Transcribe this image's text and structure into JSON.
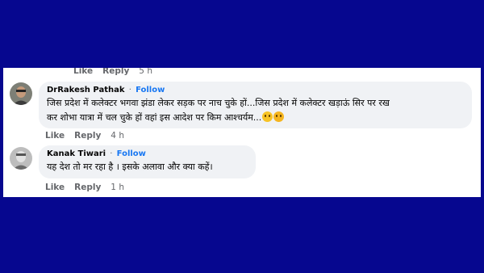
{
  "top_actions": {
    "like": "Like",
    "reply": "Reply",
    "time": "5 h"
  },
  "comments": [
    {
      "author": "DrRakesh Pathak",
      "separator": "·",
      "follow": "Follow",
      "line1": "जिस प्रदेश में कलेक्टर भगवा झंडा लेकर सड़क पर नाच चुके हों...जिस प्रदेश में कलेक्टर खड़ाऊं सिर पर रख",
      "line2": "कर शोभा यात्रा में चल चुके हों वहां इस आदेश पर किम आश्चर्यम...",
      "emojis": [
        "thinking-face-emoji",
        "flushed-face-emoji"
      ],
      "like": "Like",
      "reply": "Reply",
      "time": "4 h"
    },
    {
      "author": "Kanak Tiwari",
      "separator": "·",
      "follow": "Follow",
      "line1": "यह देश तो मर रहा है । इसके अलावा और क्या कहें।",
      "like": "Like",
      "reply": "Reply",
      "time": "1 h"
    }
  ],
  "colors": {
    "background": "#06078f",
    "bubble": "#f0f2f5",
    "link": "#1877f2",
    "meta": "#65676b"
  }
}
